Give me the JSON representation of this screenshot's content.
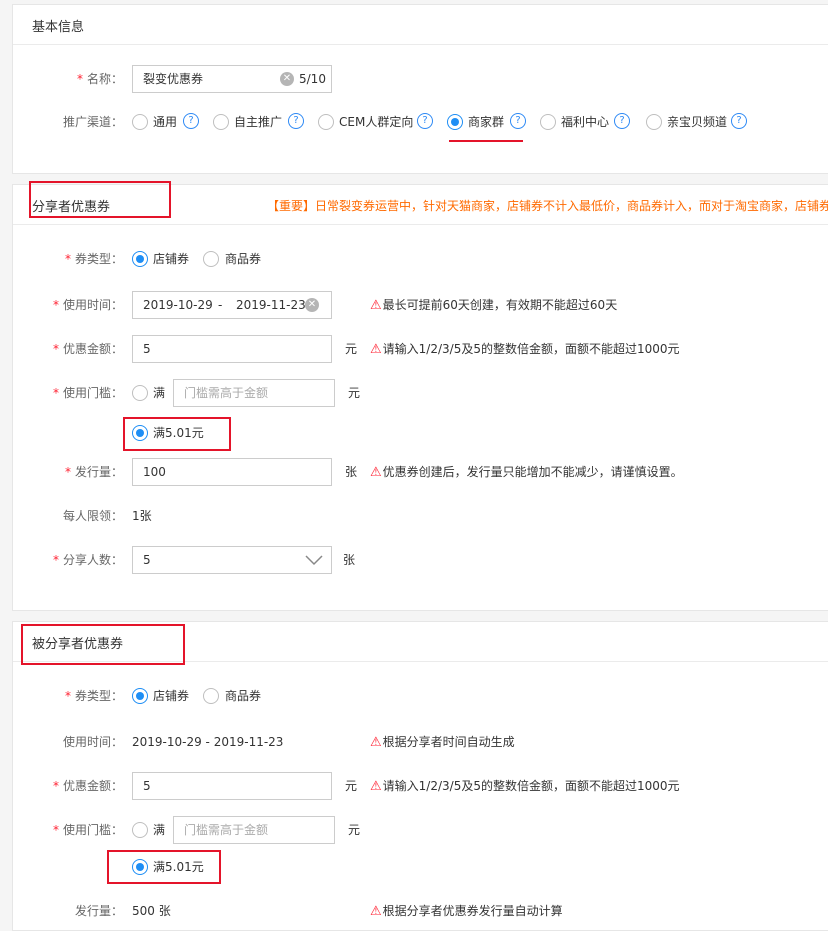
{
  "basic": {
    "title": "基本信息",
    "name_label": "名称",
    "name_value": "裂变优惠券",
    "name_count": "5/10",
    "channel_label": "推广渠道",
    "channels": [
      "通用",
      "自主推广",
      "CEM人群定向",
      "商家群",
      "福利中心",
      "亲宝贝频道"
    ],
    "selected_channel": "商家群"
  },
  "sharer": {
    "title": "分享者优惠券",
    "notice": "【重要】日常裂变券运营中，针对天猫商家，店铺券不计入最低价，商品券计入，而对于淘宝商家，店铺券",
    "type_label": "券类型",
    "type_options": [
      "店铺券",
      "商品券"
    ],
    "time_label": "使用时间",
    "start_date": "2019-10-29",
    "date_sep": "-",
    "end_date": "2019-11-23",
    "time_hint": "最长可提前60天创建，有效期不能超过60天",
    "amount_label": "优惠金额",
    "amount_value": "5",
    "yuan": "元",
    "amount_hint": "请输入1/2/3/5及5的整数倍金额，面额不能超过1000元",
    "threshold_label": "使用门槛",
    "threshold_full": "满",
    "threshold_placeholder": "门槛需高于金额",
    "threshold_option": "满5.01元",
    "issue_label": "发行量",
    "issue_value": "100",
    "zhang": "张",
    "issue_hint": "优惠券创建后，发行量只能增加不能减少，请谨慎设置。",
    "limit_label": "每人限领：",
    "limit_value": "1张",
    "share_count_label": "分享人数",
    "share_count_value": "5"
  },
  "shared": {
    "title": "被分享者优惠券",
    "type_label": "券类型",
    "type_options": [
      "店铺券",
      "商品券"
    ],
    "time_label": "使用时间：",
    "time_value": "2019-10-29 - 2019-11-23",
    "time_hint": "根据分享者时间自动生成",
    "amount_label": "优惠金额",
    "amount_value": "5",
    "yuan": "元",
    "amount_hint": "请输入1/2/3/5及5的整数倍金额，面额不能超过1000元",
    "threshold_label": "使用门槛",
    "threshold_full": "满",
    "threshold_placeholder": "门槛需高于金额",
    "threshold_option": "满5.01元",
    "issue_label": "发行量：",
    "issue_value": "500 张",
    "issue_hint": "根据分享者优惠券发行量自动计算"
  },
  "colors": {
    "accent": "#1e8ef5",
    "required": "#ff2233",
    "highlight": "#e4142a",
    "notice": "#ff6a00"
  }
}
